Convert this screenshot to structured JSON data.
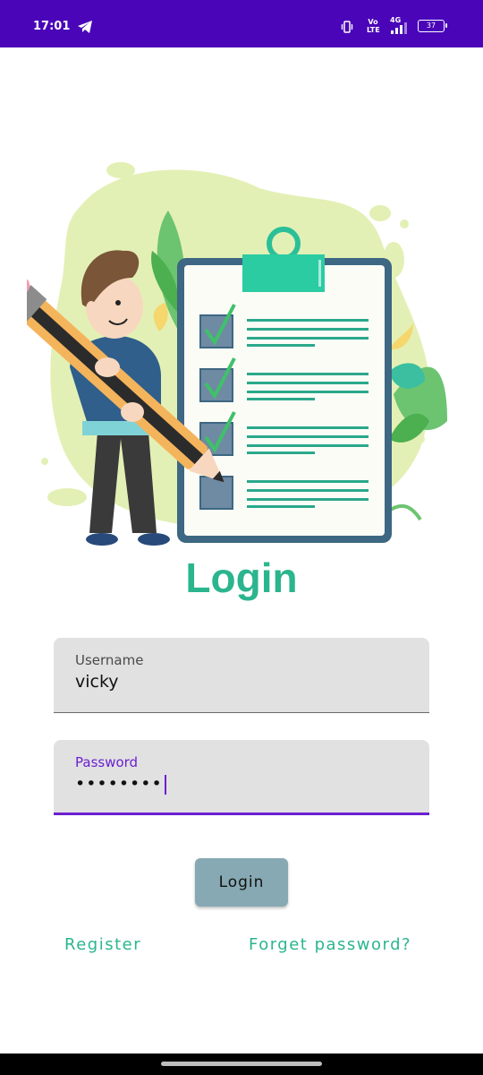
{
  "status_bar": {
    "time": "17:01",
    "volte_line1": "Vo",
    "volte_line2": "LTE",
    "network": "4G",
    "battery": "37",
    "background": "#4a05b8"
  },
  "title": "Login",
  "username_field": {
    "label": "Username",
    "value": "vicky"
  },
  "password_field": {
    "label": "Password",
    "value": "••••••••"
  },
  "login_button": "Login",
  "register_link": "Register",
  "forget_link": "Forget password?",
  "colors": {
    "accent": "#2bb58e",
    "focus": "#6b1fd1",
    "button": "#87a9b3",
    "field_bg": "#e1e1e1"
  },
  "icons": [
    "telegram-icon",
    "vibrate-icon",
    "signal-icon",
    "battery-icon"
  ]
}
